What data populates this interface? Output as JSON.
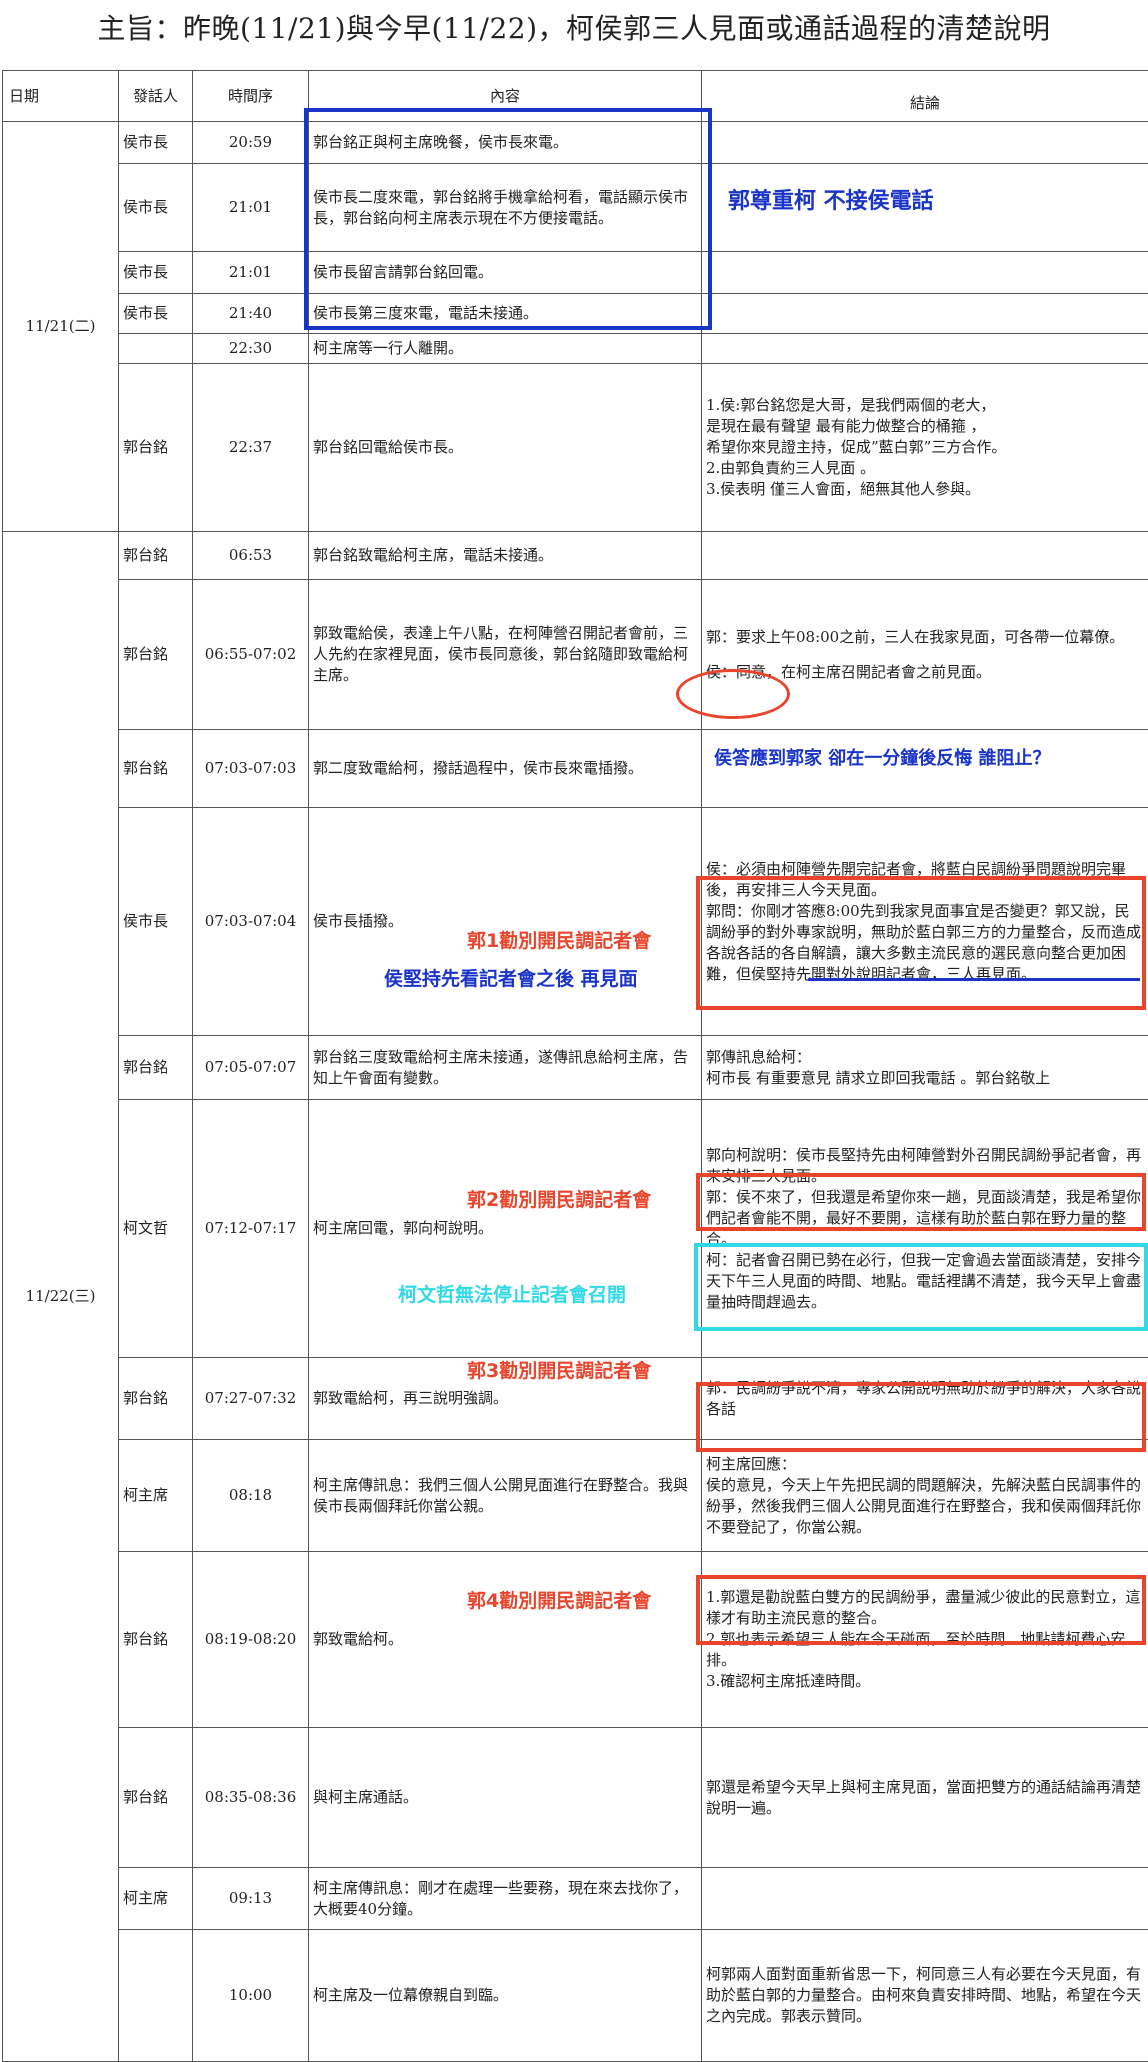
{
  "title": "主旨：昨晚(11/21)與今早(11/22)，柯侯郭三人見面或通話過程的清楚說明",
  "headers": {
    "date": "日期",
    "speaker": "發話人",
    "time": "時間序",
    "content": "內容",
    "conclusion": "結論"
  },
  "dates": {
    "d1": "11/21(二)",
    "d2": "11/22(三)"
  },
  "rows": [
    {
      "speaker": "侯市長",
      "time": "20:59",
      "content": "郭台銘正與柯主席晚餐，侯市長來電。",
      "notes": []
    },
    {
      "speaker": "侯市長",
      "time": "21:01",
      "content": "侯市長二度來電，郭台銘將手機拿給柯看，電話顯示侯市長，郭台銘向柯主席表示現在不方便接電話。",
      "notes": []
    },
    {
      "speaker": "侯市長",
      "time": "21:01",
      "content": "侯市長留言請郭台銘回電。",
      "notes": []
    },
    {
      "speaker": "侯市長",
      "time": "21:40",
      "content": "侯市長第三度來電，電話未接通。",
      "notes": []
    },
    {
      "speaker": "",
      "time": "22:30",
      "content": "柯主席等一行人離開。",
      "notes": []
    },
    {
      "speaker": "郭台銘",
      "time": "22:37",
      "content": "郭台銘回電給侯市長。",
      "notes": [
        "1.侯:郭台銘您是大哥，是我們兩個的老大，",
        "是現在最有聲望 最有能力做整合的桶箍 ，",
        "希望你來見證主持，促成”藍白郭”三方合作。",
        "2.由郭負責約三人見面 。",
        "3.侯表明 僅三人會面，絕無其他人參與。"
      ]
    },
    {
      "speaker": "郭台銘",
      "time": "06:53",
      "content": "郭台銘致電給柯主席，電話未接通。",
      "notes": []
    },
    {
      "speaker": "郭台銘",
      "time": "06:55-07:02",
      "content": "郭致電給侯，表達上午八點，在柯陣營召開記者會前，三人先約在家裡見面，侯市長同意後，郭台銘隨即致電給柯主席。",
      "notes": [
        "郭：要求上午08:00之前，三人在我家見面，可各帶一位幕僚。",
        "侯：同意，在柯主席召開記者會之前見面。"
      ]
    },
    {
      "speaker": "郭台銘",
      "time": "07:03-07:03",
      "content": "郭二度致電給柯，撥話過程中，侯市長來電插撥。",
      "notes": []
    },
    {
      "speaker": "侯市長",
      "time": "07:03-07:04",
      "content": "侯市長插撥。",
      "notes": [
        "侯：必須由柯陣營先開完記者會，將藍白民調紛爭問題說明完畢後，再安排三人今天見面。",
        "郭問：你剛才答應8:00先到我家見面事宜是否變更？郭又說，民調紛爭的對外專家說明，無助於藍白郭三方的力量整合，反而造成各說各話的各自解讀，讓大多數主流民意的選民意向整合更加困難，但侯堅持先開對外說明記者會，三人再見面。"
      ]
    },
    {
      "speaker": "郭台銘",
      "time": "07:05-07:07",
      "content": "郭台銘三度致電給柯主席未接通，遂傳訊息給柯主席，告知上午會面有變數。",
      "notes": [
        "郭傳訊息給柯：",
        "柯市長 有重要意見 請求立即回我電話 。郭台銘敬上"
      ]
    },
    {
      "speaker": "柯文哲",
      "time": "07:12-07:17",
      "content": "柯主席回電，郭向柯說明。",
      "notes": [
        "郭向柯說明：侯市長堅持先由柯陣營對外召開民調紛爭記者會，再來安排三人見面。",
        "郭：侯不來了，但我還是希望你來一趟，見面談清楚，我是希望你們記者會能不開，最好不要開，這樣有助於藍白郭在野力量的整合。",
        "柯：記者會召開已勢在必行，但我一定會過去當面談清楚，安排今天下午三人見面的時間、地點。電話裡講不清楚，我今天早上會盡量抽時間趕過去。"
      ]
    },
    {
      "speaker": "郭台銘",
      "time": "07:27-07:32",
      "content": "郭致電給柯，再三說明強調。",
      "notes": [
        "郭：民調紛爭說不清，專家公開說明無助於紛爭的解決，大家各說各話"
      ]
    },
    {
      "speaker": "柯主席",
      "time": "08:18",
      "content": "柯主席傳訊息：我們三個人公開見面進行在野整合。我與侯市長兩個拜託你當公親。",
      "notes": [
        "柯主席回應：",
        "侯的意見，今天上午先把民調的問題解決，先解決藍白民調事件的紛爭，然後我們三個人公開見面進行在野整合，我和侯兩個拜託你不要登記了，你當公親。"
      ]
    },
    {
      "speaker": "郭台銘",
      "time": "08:19-08:20",
      "content": "郭致電給柯。",
      "notes": [
        "1.郭還是勸說藍白雙方的民調紛爭，盡量減少彼此的民意對立，這樣才有助主流民意的整合。",
        "2.郭也表示希望三人能在今天碰面，至於時間、地點請柯費心安排。",
        "3.確認柯主席抵達時間。"
      ]
    },
    {
      "speaker": "郭台銘",
      "time": "08:35-08:36",
      "content": "與柯主席通話。",
      "notes": [
        "郭還是希望今天早上與柯主席見面，當面把雙方的通話結論再清楚說明一遍。"
      ]
    },
    {
      "speaker": "柯主席",
      "time": "09:13",
      "content": "柯主席傳訊息：剛才在處理一些要務，現在來去找你了，大概要40分鐘。",
      "notes": []
    },
    {
      "speaker": "",
      "time": "10:00",
      "content": "柯主席及一位幕僚親自到臨。",
      "notes": [
        "柯郭兩人面對面重新省思一下，柯同意三人有必要在今天見面，有助於藍白郭的力量整合。由柯來負責安排時間、地點，希望在今天之內完成。郭表示贊同。"
      ]
    }
  ],
  "annotations": {
    "a1": "郭尊重柯 不接侯電話",
    "a2": "侯答應到郭家 卻在一分鐘後反悔 誰阻止？",
    "a3": "郭1勸別開民調記者會",
    "a4": "侯堅持先看記者會之後 再見面",
    "a5": "郭2勸別開民調記者會",
    "a6": "柯文哲無法停止記者會召開",
    "a7": "郭3勸別開民調記者會",
    "a8": "郭4勸別開民調記者會"
  },
  "colors": {
    "blue": "#1a34c8",
    "red": "#e8452c",
    "cyan": "#2fd9e6",
    "border": "#555555"
  }
}
